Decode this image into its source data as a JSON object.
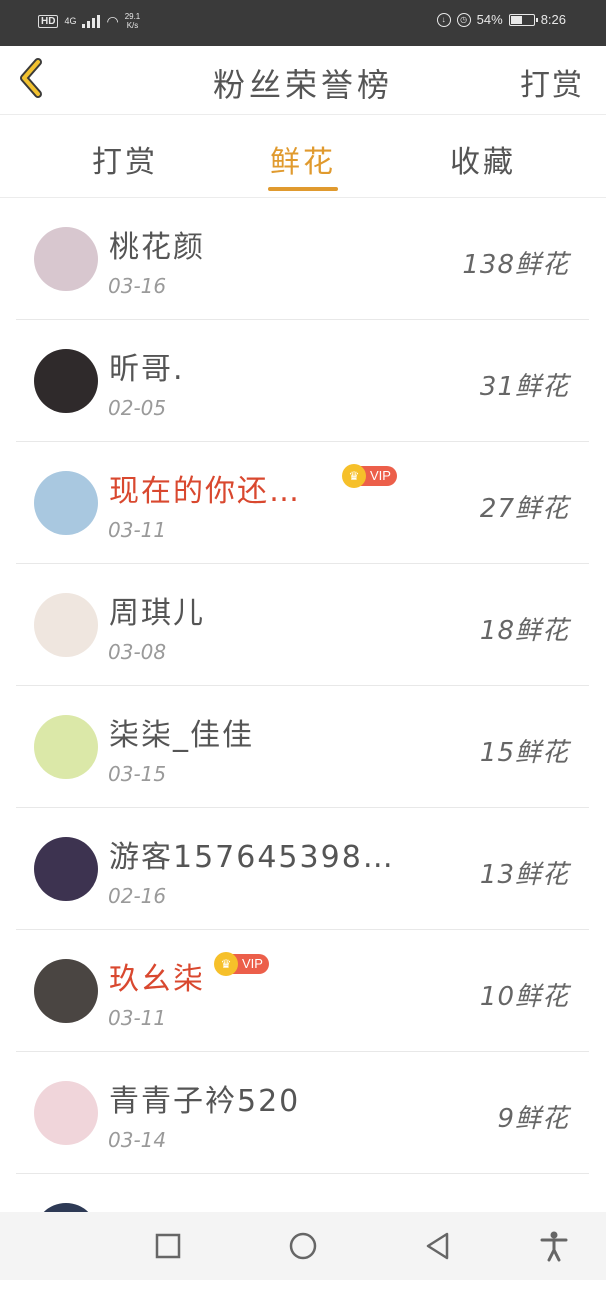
{
  "status_bar": {
    "hd": "HD",
    "network": "4G",
    "speed_value": "29.1",
    "speed_unit": "K/s",
    "battery": "54%",
    "time": "8:26",
    "battery_level": 0.54
  },
  "header": {
    "title": "粉丝荣誉榜",
    "right_action": "打赏",
    "back_icon": "chevron-left-icon"
  },
  "tabs": [
    {
      "label": "打赏",
      "active": false
    },
    {
      "label": "鲜花",
      "active": true
    },
    {
      "label": "收藏",
      "active": false
    }
  ],
  "colors": {
    "accent": "#e09a2e",
    "vip_name": "#d9482f",
    "vip_badge": "#ec5f4a",
    "crown": "#f6c02a"
  },
  "vip_label": "VIP",
  "fans": [
    {
      "name": "桃花颜",
      "date": "03-16",
      "count": "138鲜花",
      "vip": false,
      "avatar_color": "#d8c7cf"
    },
    {
      "name": "昕哥.",
      "date": "02-05",
      "count": "31鲜花",
      "vip": false,
      "avatar_color": "#2f2a2b"
    },
    {
      "name": "现在的你还…",
      "date": "03-11",
      "count": "27鲜花",
      "vip": true,
      "avatar_color": "#a9c8e0"
    },
    {
      "name": "周琪儿",
      "date": "03-08",
      "count": "18鲜花",
      "vip": false,
      "avatar_color": "#efe6df"
    },
    {
      "name": "柒柒_佳佳",
      "date": "03-15",
      "count": "15鲜花",
      "vip": false,
      "avatar_color": "#dbe8a8"
    },
    {
      "name": "游客157645398…",
      "date": "02-16",
      "count": "13鲜花",
      "vip": false,
      "avatar_color": "#3d3350"
    },
    {
      "name": "玖幺柒",
      "date": "03-11",
      "count": "10鲜花",
      "vip": true,
      "avatar_color": "#4a4542"
    },
    {
      "name": "青青子衿520",
      "date": "03-14",
      "count": "9鲜花",
      "vip": false,
      "avatar_color": "#f0d5da"
    }
  ],
  "bottom_nav": [
    "square-icon",
    "circle-home-icon",
    "triangle-back-icon",
    "accessibility-icon"
  ]
}
